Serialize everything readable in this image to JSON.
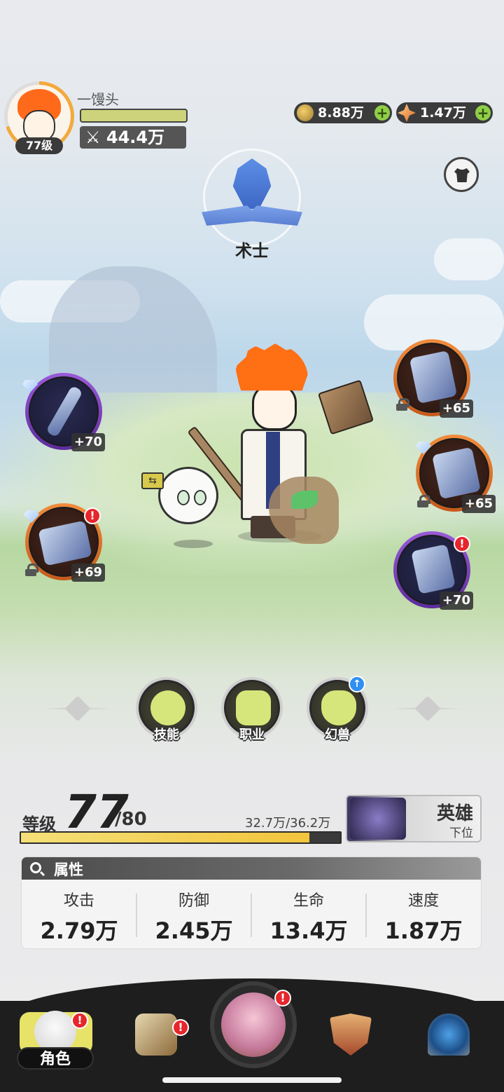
{
  "player": {
    "name": "一馒头",
    "level_badge": "77级",
    "power": "44.4万"
  },
  "currency": {
    "gold": "8.88万",
    "crystal": "1.47万"
  },
  "class": {
    "name": "术士"
  },
  "equipment": {
    "weapon": {
      "level": "+70",
      "locked": false
    },
    "book": {
      "level": "+69",
      "locked": true
    },
    "helmet": {
      "level": "+65",
      "locked": true
    },
    "armor": {
      "level": "+65",
      "locked": true
    },
    "boots": {
      "level": "+70",
      "locked": false
    }
  },
  "features": [
    {
      "label": "技能"
    },
    {
      "label": "职业"
    },
    {
      "label": "幻兽"
    }
  ],
  "level": {
    "label": "等级",
    "current": "77",
    "max": "/80",
    "exp_text": "32.7万/36.2万",
    "exp_progress": 0.903
  },
  "rank": {
    "title": "英雄",
    "subtitle": "下位"
  },
  "attributes": {
    "title": "属性",
    "items": [
      {
        "name": "攻击",
        "value": "2.79万"
      },
      {
        "name": "防御",
        "value": "2.45万"
      },
      {
        "name": "生命",
        "value": "13.4万"
      },
      {
        "name": "速度",
        "value": "1.87万"
      }
    ]
  },
  "nav": {
    "active_label": "角色"
  },
  "badges": {
    "alert": "!",
    "up": "↑",
    "plus": "+",
    "swap": "⇆"
  }
}
